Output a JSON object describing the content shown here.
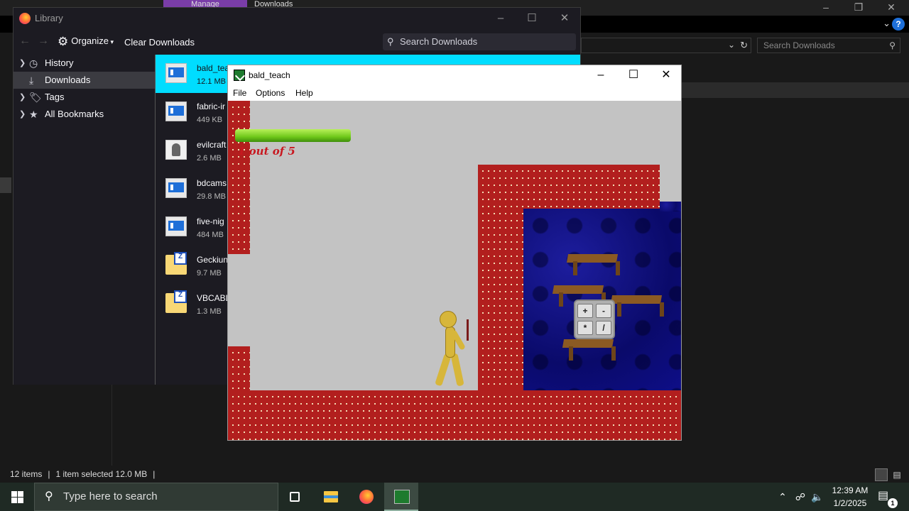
{
  "explorer": {
    "ribbon_tabs": [
      "Manage",
      "Downloads"
    ],
    "search_placeholder": "Search Downloads",
    "status": {
      "items": "12 items",
      "selected": "1 item selected  12.0 MB"
    }
  },
  "library": {
    "title": "Library",
    "toolbar": {
      "organize_label": "Organize",
      "clear_label": "Clear Downloads",
      "search_placeholder": "Search Downloads"
    },
    "tree": [
      {
        "label": "History",
        "icon": "clock-icon"
      },
      {
        "label": "Downloads",
        "icon": "download-icon"
      },
      {
        "label": "Tags",
        "icon": "tag-icon"
      },
      {
        "label": "All Bookmarks",
        "icon": "star-icon"
      }
    ],
    "downloads": [
      {
        "name": "bald_teac",
        "size": "12.1 MB",
        "icon": "exe-icon"
      },
      {
        "name": "fabric-ir",
        "size": "449 KB",
        "icon": "exe-icon"
      },
      {
        "name": "evilcraft",
        "size": "2.6 MB",
        "icon": "java-icon"
      },
      {
        "name": "bdcams",
        "size": "29.8 MB",
        "icon": "exe-icon"
      },
      {
        "name": "five-nig",
        "size": "484 MB",
        "icon": "exe-icon"
      },
      {
        "name": "Geckiun",
        "size": "9.7 MB",
        "icon": "zip-icon"
      },
      {
        "name": "VBCABL",
        "size": "1.3 MB",
        "icon": "zip-icon"
      }
    ]
  },
  "game": {
    "title": "bald_teach",
    "menu": [
      "File",
      "Options",
      "Help"
    ],
    "hud_text": "1 out of 5",
    "health_level": 1.0,
    "calculator_keys": [
      "+",
      "-",
      "*",
      "/"
    ]
  },
  "taskbar": {
    "search_placeholder": "Type here to search",
    "time": "12:39 AM",
    "date": "1/2/2025",
    "notification_count": "1"
  }
}
